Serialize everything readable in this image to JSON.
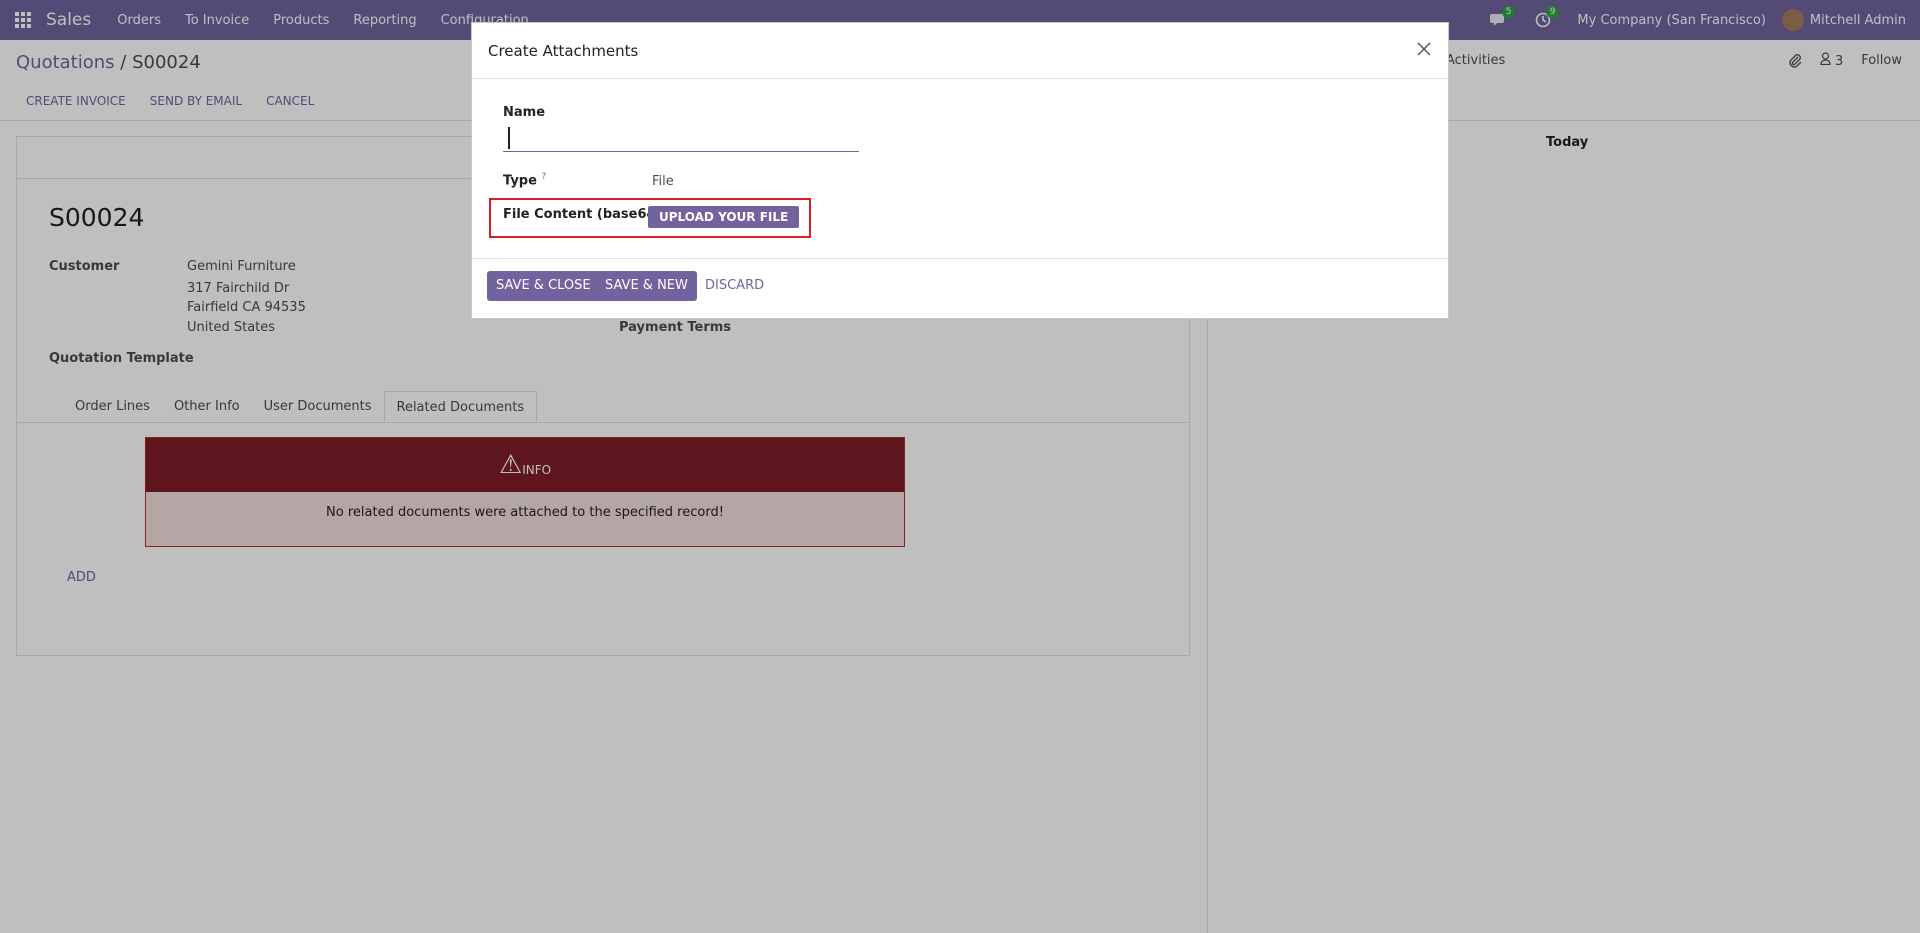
{
  "navbar": {
    "app_name": "Sales",
    "menu": [
      "Orders",
      "To Invoice",
      "Products",
      "Reporting",
      "Configuration"
    ],
    "messages_count": "5",
    "activities_count": "9",
    "company": "My Company (San Francisco)",
    "user": "Mitchell Admin"
  },
  "control_panel": {
    "breadcrumb_parent": "Quotations",
    "breadcrumb_sep": "/",
    "breadcrumb_current": "S00024",
    "actions": [
      "CREATE INVOICE",
      "SEND BY EMAIL",
      "CANCEL"
    ],
    "activities_label": "Activities",
    "followers_count": "3",
    "follow_label": "Follow"
  },
  "form": {
    "record_name": "S00024",
    "customer_label": "Customer",
    "customer_name": "Gemini Furniture",
    "address_line1": "317 Fairchild Dr",
    "address_line2": "Fairfield CA 94535",
    "address_line3": "United States",
    "payment_terms_label": "Payment Terms",
    "quotation_template_label": "Quotation Template",
    "tabs": [
      "Order Lines",
      "Other Info",
      "User Documents",
      "Related Documents"
    ],
    "alert_title": "INFO",
    "alert_message": "No related documents were attached to the specified record!",
    "add_label": "ADD"
  },
  "chatter": {
    "today_label": "Today"
  },
  "dialog": {
    "title": "Create Attachments",
    "name_label": "Name",
    "name_value": "",
    "type_label": "Type",
    "type_help": "?",
    "type_value": "File",
    "file_content_label": "File Content (base64)",
    "upload_label": "UPLOAD YOUR FILE",
    "save_close_label": "SAVE & CLOSE",
    "save_new_label": "SAVE & NEW",
    "discard_label": "DISCARD"
  },
  "colors": {
    "brand": "#71639e",
    "alert_header": "#7f1d28",
    "highlight": "#e01b24"
  }
}
